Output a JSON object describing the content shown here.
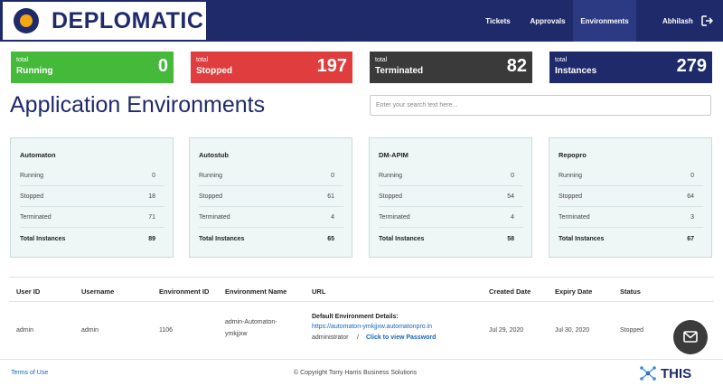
{
  "brand": {
    "name": "DEPLOMATIC"
  },
  "nav": {
    "tickets": "Tickets",
    "approvals": "Approvals",
    "environments": "Environments",
    "user": "Abhilash"
  },
  "stats": {
    "running": {
      "small": "total",
      "label": "Running",
      "value": "0"
    },
    "stopped": {
      "small": "total",
      "label": "Stopped",
      "value": "197"
    },
    "terminated": {
      "small": "total",
      "label": "Terminated",
      "value": "82"
    },
    "instances": {
      "small": "total",
      "label": "Instances",
      "value": "279"
    }
  },
  "page": {
    "title": "Application Environments",
    "search_placeholder": "Enter your search text here..."
  },
  "env_labels": {
    "running": "Running",
    "stopped": "Stopped",
    "terminated": "Terminated",
    "total": "Total Instances"
  },
  "envs": [
    {
      "name": "Automaton",
      "running": "0",
      "stopped": "18",
      "terminated": "71",
      "total": "89"
    },
    {
      "name": "Autostub",
      "running": "0",
      "stopped": "61",
      "terminated": "4",
      "total": "65"
    },
    {
      "name": "DM-APIM",
      "running": "0",
      "stopped": "54",
      "terminated": "4",
      "total": "58"
    },
    {
      "name": "Repopro",
      "running": "0",
      "stopped": "64",
      "terminated": "3",
      "total": "67"
    }
  ],
  "table": {
    "headers": [
      "User ID",
      "Username",
      "Environment ID",
      "Environment Name",
      "URL",
      "Created Date",
      "Expiry Date",
      "Status"
    ],
    "rows": [
      {
        "user_id": "admin",
        "username": "admin",
        "env_id": "1106",
        "env_name_1": "admin-Automaton-",
        "env_name_2": "ymkjjxw",
        "url_title": "Default Environment Details:",
        "url_link": "https://automaton-ymkjjxw.automatonpro.in",
        "url_user": "administrator",
        "url_sep": "/",
        "url_password": "Click to view Password",
        "created": "Jul 29, 2020",
        "expiry": "Jul 30, 2020",
        "status": "Stopped"
      }
    ]
  },
  "footer": {
    "terms": "Terms of Use",
    "copyright": "© Copyright Torry Harris Business Solutions",
    "logo": "THIS"
  },
  "colors": {
    "navy": "#1f2a6b",
    "running": "#44b93a",
    "stopped": "#e03e3e",
    "terminated": "#3a3a3a",
    "gold": "#f3a712"
  },
  "icons": {
    "logout": "logout-icon",
    "chat": "mail-icon",
    "logo": "deplomatic-logo-icon"
  }
}
